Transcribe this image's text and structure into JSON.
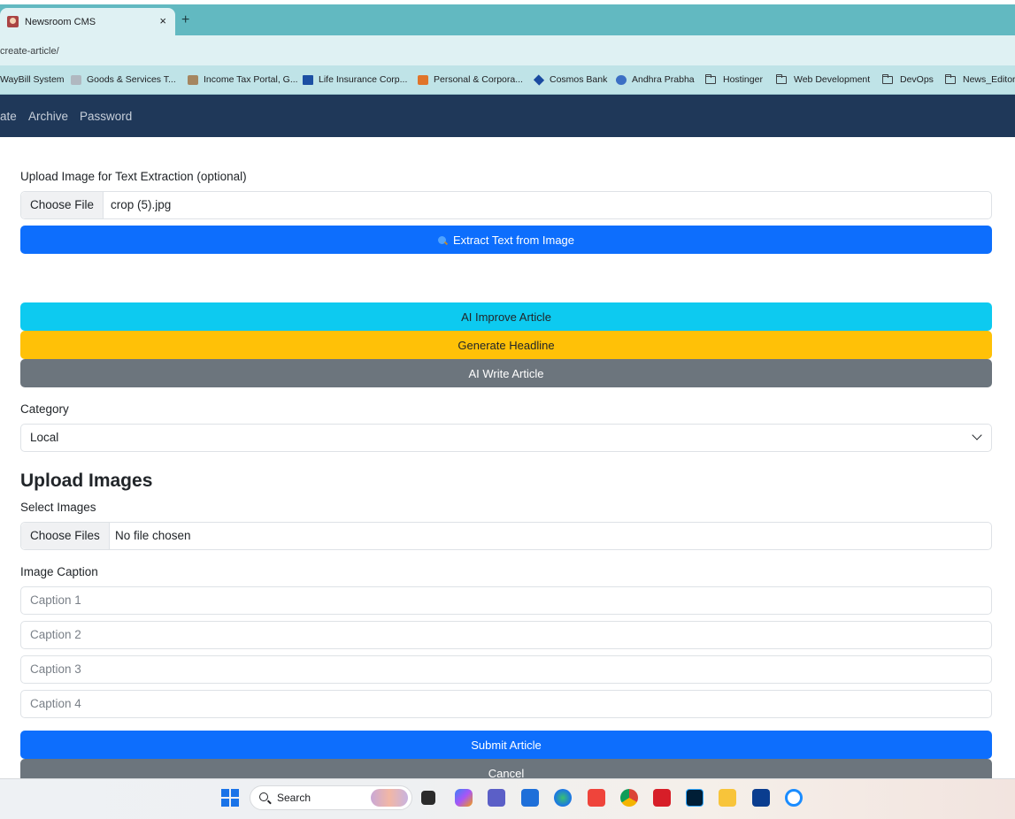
{
  "browser": {
    "tab_title": "Newsroom CMS",
    "tab_close": "×",
    "new_tab": "+",
    "url": "create-article/",
    "bookmarks": [
      {
        "label": "WayBill System",
        "icon": "generic"
      },
      {
        "label": "Goods & Services T...",
        "icon": "emblem"
      },
      {
        "label": "Income Tax Portal, G...",
        "icon": "emblem"
      },
      {
        "label": "Life Insurance Corp...",
        "icon": "lic"
      },
      {
        "label": "Personal & Corpora...",
        "icon": "bank"
      },
      {
        "label": "Cosmos Bank",
        "icon": "cosmos"
      },
      {
        "label": "Andhra Prabha",
        "icon": "globe"
      },
      {
        "label": "Hostinger",
        "icon": "folder"
      },
      {
        "label": "Web Development",
        "icon": "folder"
      },
      {
        "label": "DevOps",
        "icon": "folder"
      },
      {
        "label": "News_Editoria",
        "icon": "folder"
      }
    ]
  },
  "nav": {
    "items": [
      "ate",
      "Archive",
      "Password"
    ]
  },
  "form": {
    "extract_label": "Upload Image for Text Extraction (optional)",
    "extract_file_button": "Choose File",
    "extract_file_name": "crop (5).jpg",
    "extract_button": "Extract Text from Image",
    "ai_improve_button": "AI Improve Article",
    "generate_headline_button": "Generate Headline",
    "ai_write_button": "AI Write Article",
    "category_label": "Category",
    "category_value": "Local",
    "upload_images_title": "Upload Images",
    "select_images_label": "Select Images",
    "select_images_button": "Choose Files",
    "select_images_status": "No file chosen",
    "caption_label": "Image Caption",
    "caption_placeholders": [
      "Caption 1",
      "Caption 2",
      "Caption 3",
      "Caption 4"
    ],
    "submit_button": "Submit Article",
    "cancel_button": "Cancel"
  },
  "taskbar": {
    "search_text": "Search",
    "apps": [
      "file-explorer-dark",
      "copilot",
      "teams",
      "store",
      "edge",
      "anydesk",
      "chrome",
      "yatra",
      "photoshop",
      "folder",
      "ftp",
      "sync"
    ]
  },
  "colors": {
    "tabbar": "#62b9c1",
    "nav_bg": "#1f3859",
    "primary": "#0d6efd",
    "info": "#0dcaf0",
    "warning": "#ffc107",
    "secondary": "#6c757d"
  }
}
